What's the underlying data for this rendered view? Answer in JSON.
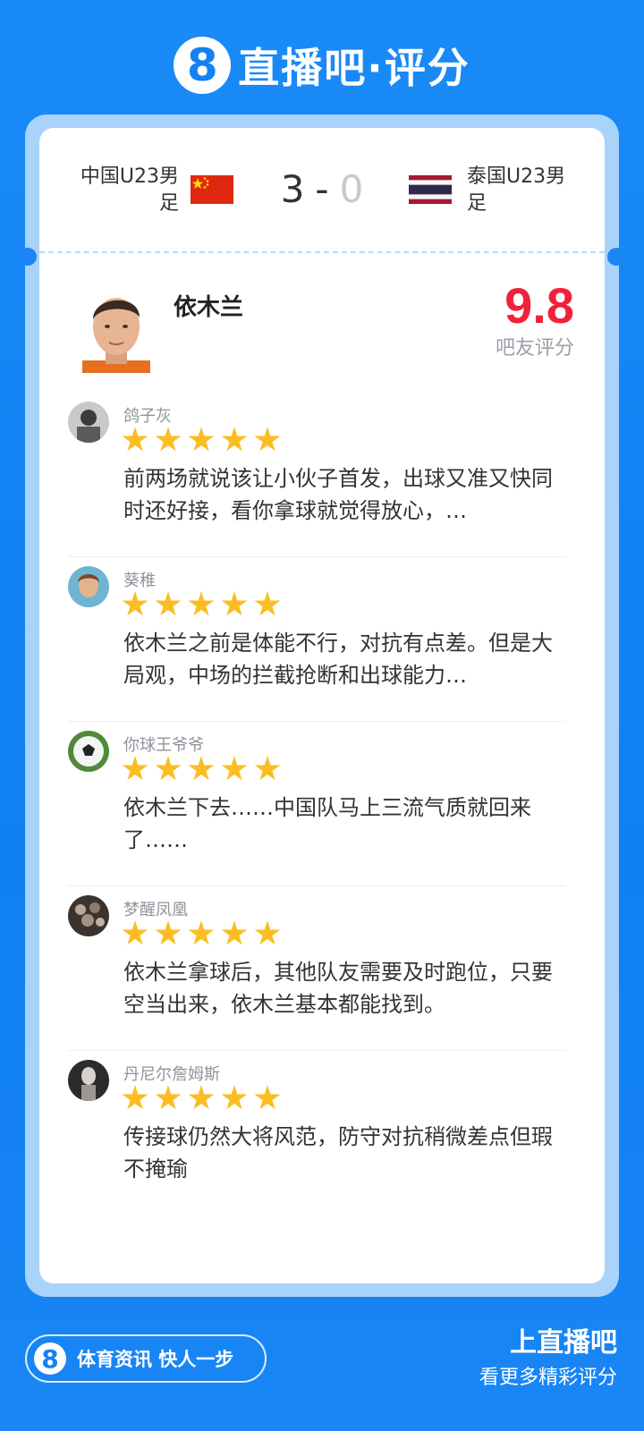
{
  "brand": {
    "logo_glyph": "8",
    "title": "直播吧·评分"
  },
  "match": {
    "home_team": "中国U23男足",
    "away_team": "泰国U23男足",
    "home_score": "3",
    "separator": "-",
    "away_score": "0"
  },
  "player": {
    "name": "依木兰",
    "rating": "9.8",
    "rating_label": "吧友评分"
  },
  "comments": [
    {
      "user": "鸽子灰",
      "stars": 5,
      "text": "前两场就说该让小伙子首发，出球又准又快同时还好接，看你拿球就觉得放心，…"
    },
    {
      "user": "葵稚",
      "stars": 5,
      "text": "依木兰之前是体能不行，对抗有点差。但是大局观，中场的拦截抢断和出球能力…"
    },
    {
      "user": "你球王爷爷",
      "stars": 5,
      "text": "依木兰下去……中国队马上三流气质就回来了……"
    },
    {
      "user": "梦醒凤凰",
      "stars": 5,
      "text": "依木兰拿球后，其他队友需要及时跑位，只要空当出来，依木兰基本都能找到。"
    },
    {
      "user": "丹尼尔詹姆斯",
      "stars": 5,
      "text": "传接球仍然大将风范，防守对抗稍微差点但瑕不掩瑜"
    }
  ],
  "footer": {
    "logo_glyph": "8",
    "slogan": "体育资讯 快人一步",
    "cta": "上直播吧",
    "sub": "看更多精彩评分"
  },
  "colors": {
    "brand_blue": "#1482f4",
    "rating_red": "#f0223b",
    "star_yellow": "#fbbd22"
  }
}
